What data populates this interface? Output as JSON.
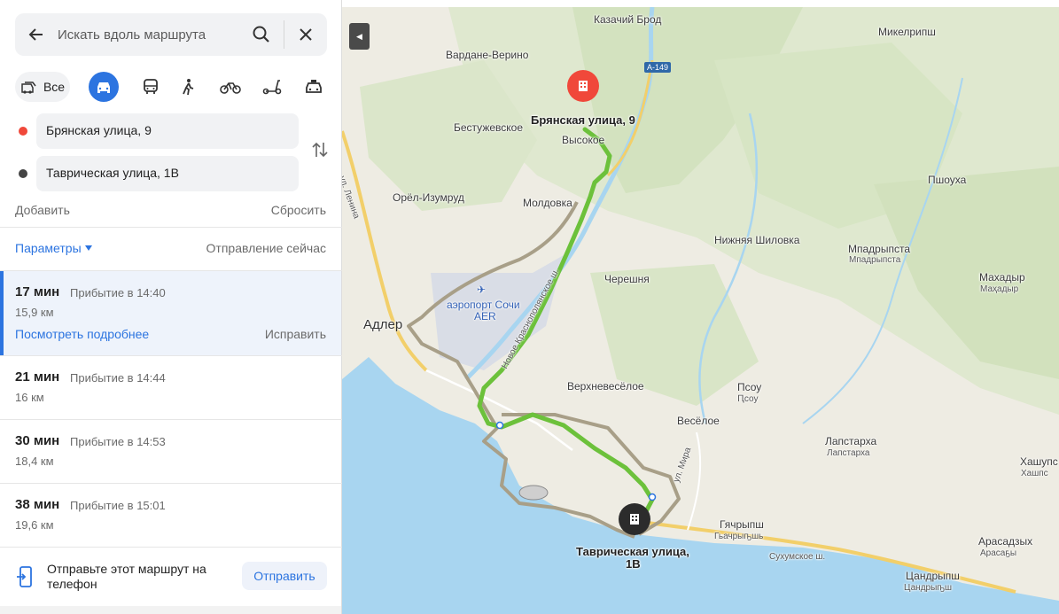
{
  "search": {
    "placeholder": "Искать вдоль маршрута"
  },
  "modes": {
    "all_label": "Все"
  },
  "points": {
    "from": "Брянская улица, 9",
    "to": "Таврическая улица, 1В"
  },
  "actions": {
    "add": "Добавить",
    "reset": "Сбросить"
  },
  "params": {
    "label": "Параметры",
    "departure": "Отправление сейчас"
  },
  "routes": [
    {
      "time": "17 мин",
      "arrival": "Прибытие в 14:40",
      "distance": "15,9 км",
      "details": "Посмотреть подробнее",
      "fix": "Исправить",
      "selected": true
    },
    {
      "time": "21 мин",
      "arrival": "Прибытие в 14:44",
      "distance": "16 км"
    },
    {
      "time": "30 мин",
      "arrival": "Прибытие в 14:53",
      "distance": "18,4 км"
    },
    {
      "time": "38 мин",
      "arrival": "Прибытие в 15:01",
      "distance": "19,6 км"
    }
  ],
  "send": {
    "text": "Отправьте этот маршрут на телефон",
    "button": "Отправить"
  },
  "map": {
    "road_badge": "А-149",
    "labels": {
      "kazachiy_brod": "Казачий Брод",
      "mikelripsh": "Микелрипш",
      "vardane": "Вардане-Верино",
      "bestuzhevskoe": "Бестужевское",
      "vysokoe": "Высокое",
      "orel": "Орёл-Изумруд",
      "moldovka": "Молдовка",
      "pshoukha": "Пшоуха",
      "nizh_shilovka": "Нижняя Шиловка",
      "mpadrypsta": "Мпадрыпста",
      "mpadrypsta_sub": "Мпадрыпста",
      "chereshnya": "Черешня",
      "makhadyr": "Махадыр",
      "makhadyr_sub": "Маҳадыр",
      "adler": "Адлер",
      "airport_1": "аэропорт Сочи",
      "airport_2": "AER",
      "verkhneveseloe": "Верхневесёлое",
      "psou": "Псоу",
      "psou_sub": "Ԥсоу",
      "veseloe": "Весёлое",
      "lapstarkha": "Лапстарха",
      "lapstarkha_sub": "Лапстарха",
      "khashupse": "Хашупс",
      "khashupse_sub": "Хашпс",
      "gyachrypsh": "Гячрыпш",
      "gyachrypsh_sub": "Гьачрыҧшь",
      "arasadzykh": "Арасадзых",
      "arasadzykh_sub": "Арасаҕы",
      "tsandrypsh": "Цандрыпш",
      "tsandrypsh_sub": "Цандрыҧш",
      "ul_lenina": "ул. Ленина",
      "novoe_sh": "Новое Краснополянское ш.",
      "ul_mira": "ул. Мира",
      "sukhumskoe": "Сухумское ш.",
      "start_label": "Брянская улица, 9",
      "end_label_1": "Таврическая улица,",
      "end_label_2": "1В"
    }
  },
  "colors": {
    "accent": "#2c74e0",
    "route_active": "#6cc13b",
    "route_alt": "#a89f88",
    "start": "#f0483a",
    "end": "#2c2c2c",
    "sea": "#a8d5f0"
  }
}
